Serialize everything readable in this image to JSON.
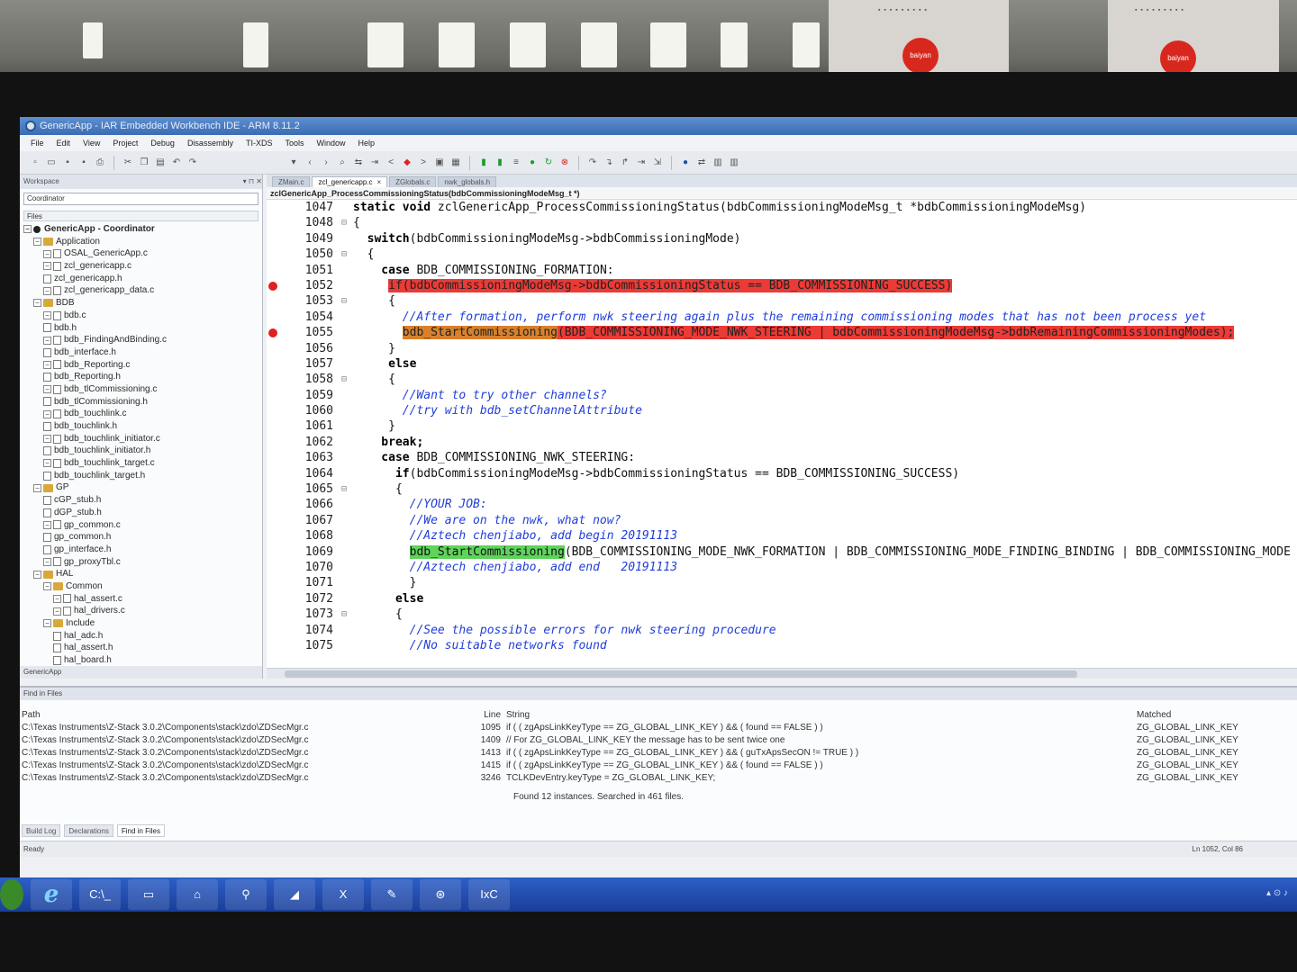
{
  "window": {
    "title": "GenericApp - IAR Embedded Workbench IDE - ARM 8.11.2"
  },
  "menu": [
    "File",
    "Edit",
    "View",
    "Project",
    "Debug",
    "Disassembly",
    "TI-XDS",
    "Tools",
    "Window",
    "Help"
  ],
  "workspace": {
    "header": "Workspace",
    "configuration": "Coordinator",
    "files_label": "Files",
    "footer": "GenericApp",
    "tree": [
      {
        "label": "GenericApp - Coordinator",
        "type": "root",
        "depth": 0
      },
      {
        "label": "Application",
        "type": "dir",
        "depth": 1
      },
      {
        "label": "OSAL_GenericApp.c",
        "type": "file",
        "depth": 2,
        "expandable": true
      },
      {
        "label": "zcl_genericapp.c",
        "type": "file",
        "depth": 2,
        "expandable": true
      },
      {
        "label": "zcl_genericapp.h",
        "type": "file",
        "depth": 2
      },
      {
        "label": "zcl_genericapp_data.c",
        "type": "file",
        "depth": 2,
        "expandable": true
      },
      {
        "label": "BDB",
        "type": "dir",
        "depth": 1
      },
      {
        "label": "bdb.c",
        "type": "file",
        "depth": 2,
        "expandable": true
      },
      {
        "label": "bdb.h",
        "type": "file",
        "depth": 2
      },
      {
        "label": "bdb_FindingAndBinding.c",
        "type": "file",
        "depth": 2,
        "expandable": true
      },
      {
        "label": "bdb_interface.h",
        "type": "file",
        "depth": 2
      },
      {
        "label": "bdb_Reporting.c",
        "type": "file",
        "depth": 2,
        "expandable": true
      },
      {
        "label": "bdb_Reporting.h",
        "type": "file",
        "depth": 2
      },
      {
        "label": "bdb_tlCommissioning.c",
        "type": "file",
        "depth": 2,
        "expandable": true
      },
      {
        "label": "bdb_tlCommissioning.h",
        "type": "file",
        "depth": 2
      },
      {
        "label": "bdb_touchlink.c",
        "type": "file",
        "depth": 2,
        "expandable": true
      },
      {
        "label": "bdb_touchlink.h",
        "type": "file",
        "depth": 2
      },
      {
        "label": "bdb_touchlink_initiator.c",
        "type": "file",
        "depth": 2,
        "expandable": true
      },
      {
        "label": "bdb_touchlink_initiator.h",
        "type": "file",
        "depth": 2
      },
      {
        "label": "bdb_touchlink_target.c",
        "type": "file",
        "depth": 2,
        "expandable": true
      },
      {
        "label": "bdb_touchlink_target.h",
        "type": "file",
        "depth": 2
      },
      {
        "label": "GP",
        "type": "dir",
        "depth": 1
      },
      {
        "label": "cGP_stub.h",
        "type": "file",
        "depth": 2
      },
      {
        "label": "dGP_stub.h",
        "type": "file",
        "depth": 2
      },
      {
        "label": "gp_common.c",
        "type": "file",
        "depth": 2,
        "expandable": true
      },
      {
        "label": "gp_common.h",
        "type": "file",
        "depth": 2
      },
      {
        "label": "gp_interface.h",
        "type": "file",
        "depth": 2
      },
      {
        "label": "gp_proxyTbl.c",
        "type": "file",
        "depth": 2,
        "expandable": true
      },
      {
        "label": "HAL",
        "type": "dir",
        "depth": 1
      },
      {
        "label": "Common",
        "type": "dir",
        "depth": 2
      },
      {
        "label": "hal_assert.c",
        "type": "file",
        "depth": 3,
        "expandable": true
      },
      {
        "label": "hal_drivers.c",
        "type": "file",
        "depth": 3,
        "expandable": true
      },
      {
        "label": "Include",
        "type": "dir",
        "depth": 2
      },
      {
        "label": "hal_adc.h",
        "type": "file",
        "depth": 3
      },
      {
        "label": "hal_assert.h",
        "type": "file",
        "depth": 3
      },
      {
        "label": "hal_board.h",
        "type": "file",
        "depth": 3
      }
    ]
  },
  "editor": {
    "tabs": [
      {
        "label": "ZMain.c",
        "active": false
      },
      {
        "label": "zcl_genericapp.c",
        "active": true
      },
      {
        "label": "ZGlobals.c",
        "active": false
      },
      {
        "label": "nwk_globals.h",
        "active": false
      }
    ],
    "close_glyph": "×",
    "function_bar": "zclGenericApp_ProcessCommissioningStatus(bdbCommissioningModeMsg_t *)",
    "lines": [
      {
        "num": "1047",
        "fold": "",
        "bp": false,
        "segs": [
          {
            "t": "static void ",
            "c": "kw"
          },
          {
            "t": "zclGenericApp_ProcessCommissioningStatus(bdbCommissioningModeMsg_t *bdbCommissioningModeMsg)",
            "c": ""
          }
        ]
      },
      {
        "num": "1048",
        "fold": "⊟",
        "bp": false,
        "segs": [
          {
            "t": "{",
            "c": ""
          }
        ]
      },
      {
        "num": "1049",
        "fold": "",
        "bp": false,
        "segs": [
          {
            "t": "  switch",
            "c": "kw"
          },
          {
            "t": "(bdbCommissioningModeMsg->bdbCommissioningMode)",
            "c": ""
          }
        ]
      },
      {
        "num": "1050",
        "fold": "⊟",
        "bp": false,
        "segs": [
          {
            "t": "  {",
            "c": ""
          }
        ]
      },
      {
        "num": "1051",
        "fold": "",
        "bp": false,
        "segs": [
          {
            "t": "    case ",
            "c": "kw"
          },
          {
            "t": "BDB_COMMISSIONING_FORMATION:",
            "c": ""
          }
        ]
      },
      {
        "num": "1052",
        "fold": "",
        "bp": true,
        "segs": [
          {
            "t": "     ",
            "c": ""
          },
          {
            "t": "if(bdbCommissioningModeMsg->bdbCommissioningStatus == BDB_COMMISSIONING_SUCCESS)",
            "c": "hl-red"
          }
        ]
      },
      {
        "num": "1053",
        "fold": "⊟",
        "bp": false,
        "segs": [
          {
            "t": "     {",
            "c": ""
          }
        ]
      },
      {
        "num": "1054",
        "fold": "",
        "bp": false,
        "segs": [
          {
            "t": "       //After formation, perform nwk steering again plus the remaining commissioning modes that has not been process yet",
            "c": "cmt"
          }
        ]
      },
      {
        "num": "1055",
        "fold": "",
        "bp": true,
        "segs": [
          {
            "t": "       ",
            "c": ""
          },
          {
            "t": "bdb_StartCommissioning",
            "c": "hl-orange"
          },
          {
            "t": "(BDB_COMMISSIONING_MODE_NWK_STEERING | bdbCommissioningModeMsg->bdbRemainingCommissioningModes);",
            "c": "hl-red"
          }
        ]
      },
      {
        "num": "1056",
        "fold": "",
        "bp": false,
        "segs": [
          {
            "t": "     }",
            "c": ""
          }
        ]
      },
      {
        "num": "1057",
        "fold": "",
        "bp": false,
        "segs": [
          {
            "t": "     else",
            "c": "kw"
          }
        ]
      },
      {
        "num": "1058",
        "fold": "⊟",
        "bp": false,
        "segs": [
          {
            "t": "     {",
            "c": ""
          }
        ]
      },
      {
        "num": "1059",
        "fold": "",
        "bp": false,
        "segs": [
          {
            "t": "       //Want to try other channels?",
            "c": "cmt"
          }
        ]
      },
      {
        "num": "1060",
        "fold": "",
        "bp": false,
        "segs": [
          {
            "t": "       //try with bdb_setChannelAttribute",
            "c": "cmt"
          }
        ]
      },
      {
        "num": "1061",
        "fold": "",
        "bp": false,
        "segs": [
          {
            "t": "     }",
            "c": ""
          }
        ]
      },
      {
        "num": "1062",
        "fold": "",
        "bp": false,
        "segs": [
          {
            "t": "    break;",
            "c": "kw"
          }
        ]
      },
      {
        "num": "1063",
        "fold": "",
        "bp": false,
        "segs": [
          {
            "t": "    case ",
            "c": "kw"
          },
          {
            "t": "BDB_COMMISSIONING_NWK_STEERING:",
            "c": ""
          }
        ]
      },
      {
        "num": "1064",
        "fold": "",
        "bp": false,
        "segs": [
          {
            "t": "      if",
            "c": "kw"
          },
          {
            "t": "(bdbCommissioningModeMsg->bdbCommissioningStatus == BDB_COMMISSIONING_SUCCESS)",
            "c": ""
          }
        ]
      },
      {
        "num": "1065",
        "fold": "⊟",
        "bp": false,
        "segs": [
          {
            "t": "      {",
            "c": ""
          }
        ]
      },
      {
        "num": "1066",
        "fold": "",
        "bp": false,
        "segs": [
          {
            "t": "        //YOUR JOB:",
            "c": "cmt"
          }
        ]
      },
      {
        "num": "1067",
        "fold": "",
        "bp": false,
        "segs": [
          {
            "t": "        //We are on the nwk, what now?",
            "c": "cmt"
          }
        ]
      },
      {
        "num": "1068",
        "fold": "",
        "bp": false,
        "segs": [
          {
            "t": "        //Aztech chenjiabo, add begin 20191113",
            "c": "cmt"
          }
        ]
      },
      {
        "num": "1069",
        "fold": "",
        "bp": false,
        "segs": [
          {
            "t": "        ",
            "c": ""
          },
          {
            "t": "bdb_StartCommissioning",
            "c": "hl-green"
          },
          {
            "t": "(BDB_COMMISSIONING_MODE_NWK_FORMATION | BDB_COMMISSIONING_MODE_FINDING_BINDING | BDB_COMMISSIONING_MODE",
            "c": ""
          }
        ]
      },
      {
        "num": "1070",
        "fold": "",
        "bp": false,
        "segs": [
          {
            "t": "        //Aztech chenjiabo, add end   20191113",
            "c": "cmt"
          }
        ]
      },
      {
        "num": "1071",
        "fold": "",
        "bp": false,
        "segs": [
          {
            "t": "        }",
            "c": ""
          }
        ]
      },
      {
        "num": "1072",
        "fold": "",
        "bp": false,
        "segs": [
          {
            "t": "      else",
            "c": "kw"
          }
        ]
      },
      {
        "num": "1073",
        "fold": "⊟",
        "bp": false,
        "segs": [
          {
            "t": "      {",
            "c": ""
          }
        ]
      },
      {
        "num": "1074",
        "fold": "",
        "bp": false,
        "segs": [
          {
            "t": "        //See the possible errors for nwk steering procedure",
            "c": "cmt"
          }
        ]
      },
      {
        "num": "1075",
        "fold": "",
        "bp": false,
        "segs": [
          {
            "t": "        //No suitable networks found",
            "c": "cmt"
          }
        ]
      }
    ]
  },
  "find": {
    "title": "Find in Files",
    "headers": {
      "path": "Path",
      "line": "Line",
      "string": "String",
      "matched": "Matched"
    },
    "rows": [
      {
        "path": "C:\\Texas Instruments\\Z-Stack 3.0.2\\Components\\stack\\zdo\\ZDSecMgr.c",
        "line": "1095",
        "string": "if ( ( zgApsLinkKeyType == ZG_GLOBAL_LINK_KEY ) && ( found == FALSE ) )",
        "matched": "ZG_GLOBAL_LINK_KEY"
      },
      {
        "path": "C:\\Texas Instruments\\Z-Stack 3.0.2\\Components\\stack\\zdo\\ZDSecMgr.c",
        "line": "1409",
        "string": "// For ZG_GLOBAL_LINK_KEY the message has to be sent twice one",
        "matched": "ZG_GLOBAL_LINK_KEY"
      },
      {
        "path": "C:\\Texas Instruments\\Z-Stack 3.0.2\\Components\\stack\\zdo\\ZDSecMgr.c",
        "line": "1413",
        "string": "if ( ( zgApsLinkKeyType == ZG_GLOBAL_LINK_KEY ) && ( guTxApsSecON != TRUE ) )",
        "matched": "ZG_GLOBAL_LINK_KEY"
      },
      {
        "path": "C:\\Texas Instruments\\Z-Stack 3.0.2\\Components\\stack\\zdo\\ZDSecMgr.c",
        "line": "1415",
        "string": "if ( ( zgApsLinkKeyType == ZG_GLOBAL_LINK_KEY ) && ( found == FALSE ) )",
        "matched": "ZG_GLOBAL_LINK_KEY"
      },
      {
        "path": "C:\\Texas Instruments\\Z-Stack 3.0.2\\Components\\stack\\zdo\\ZDSecMgr.c",
        "line": "3246",
        "string": "TCLKDevEntry.keyType = ZG_GLOBAL_LINK_KEY;",
        "matched": "ZG_GLOBAL_LINK_KEY"
      }
    ],
    "summary": "Found 12 instances. Searched in 461 files.",
    "bottom_tabs": [
      {
        "label": "Build Log",
        "active": false
      },
      {
        "label": "Declarations",
        "active": false
      },
      {
        "label": "Find in Files",
        "active": true
      }
    ]
  },
  "status": {
    "left": "Ready",
    "position": "Ln 1052, Col 86"
  },
  "taskbar": {
    "items": [
      {
        "name": "ie-task",
        "glyph": "e"
      },
      {
        "name": "cmd-task",
        "glyph": "C:\\_"
      },
      {
        "name": "explorer-task",
        "glyph": "▭"
      },
      {
        "name": "network-task",
        "glyph": "⌂"
      },
      {
        "name": "usb-task",
        "glyph": "⚲"
      },
      {
        "name": "iar-task",
        "glyph": "◢"
      },
      {
        "name": "excel-task",
        "glyph": "X"
      },
      {
        "name": "notes-task",
        "glyph": "✎"
      },
      {
        "name": "tool-task",
        "glyph": "⊛"
      },
      {
        "name": "ixc-task",
        "glyph": "IxC"
      }
    ]
  }
}
